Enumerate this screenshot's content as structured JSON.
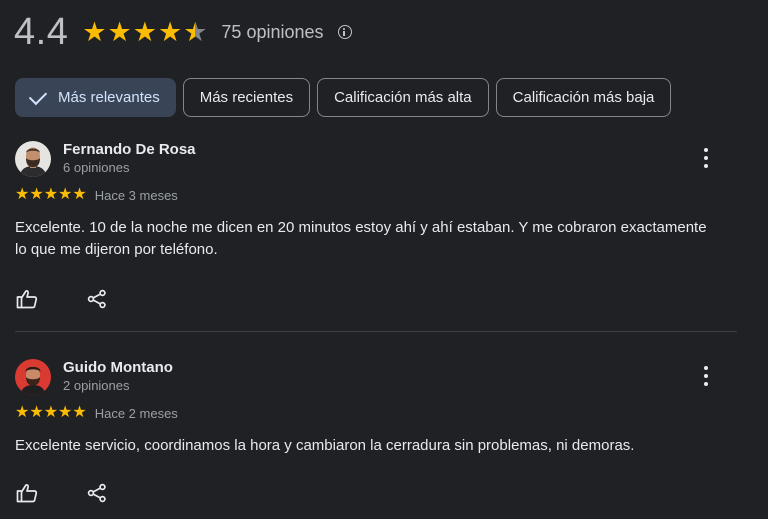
{
  "summary": {
    "rating": "4.4",
    "stars": 4.5,
    "count_label": "75 opiniones",
    "info_icon": "info-icon"
  },
  "sort_chips": [
    {
      "label": "Más relevantes",
      "selected": true
    },
    {
      "label": "Más recientes",
      "selected": false
    },
    {
      "label": "Calificación más alta",
      "selected": false
    },
    {
      "label": "Calificación más baja",
      "selected": false
    }
  ],
  "reviews": [
    {
      "author": "Fernando De Rosa",
      "author_reviews": "6 opiniones",
      "stars": 5,
      "date": "Hace 3 meses",
      "text": "Excelente. 10 de la noche me dicen en 20 minutos estoy ahí y ahí estaban. Y me cobraron exactamente lo que me dijeron por teléfono."
    },
    {
      "author": "Guido Montano",
      "author_reviews": "2 opiniones",
      "stars": 5,
      "date": "Hace 2 meses",
      "text": "Excelente servicio, coordinamos la hora y cambiaron la cerradura sin problemas, ni demoras."
    }
  ],
  "colors": {
    "background": "#202124",
    "star": "#fbbc04",
    "chip_selected_bg": "#394457",
    "chip_selected_text": "#d2e3fc",
    "text_secondary": "#9aa0a6"
  }
}
